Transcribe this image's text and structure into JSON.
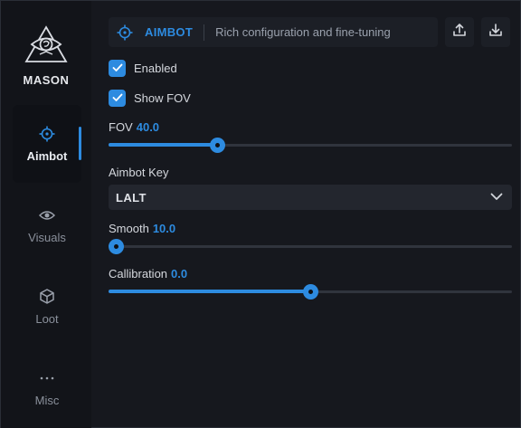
{
  "app": {
    "name": "MASON"
  },
  "sidebar": {
    "items": [
      {
        "label": "Aimbot",
        "icon": "crosshair-icon",
        "active": true
      },
      {
        "label": "Visuals",
        "icon": "eye-icon",
        "active": false
      },
      {
        "label": "Loot",
        "icon": "cube-icon",
        "active": false
      },
      {
        "label": "Misc",
        "icon": "more-dots-icon",
        "active": false
      }
    ]
  },
  "header": {
    "title": "AIMBOT",
    "subtitle": "Rich configuration and fine-tuning",
    "actions": [
      "upload-icon",
      "download-icon"
    ]
  },
  "settings": {
    "enabled": {
      "label": "Enabled",
      "checked": true
    },
    "show_fov": {
      "label": "Show FOV",
      "checked": true
    },
    "fov": {
      "label": "FOV",
      "value": "40.0",
      "fraction": 0.27
    },
    "aimbot_key": {
      "label": "Aimbot Key",
      "value": "LALT"
    },
    "smooth": {
      "label": "Smooth",
      "value": "10.0",
      "fraction": 0.018
    },
    "calibration": {
      "label": "Callibration",
      "value": "0.0",
      "fraction": 0.5
    }
  },
  "colors": {
    "accent": "#2d8be0",
    "background": "#16181e",
    "sidebar": "#121419",
    "panel": "#1c1f26"
  }
}
